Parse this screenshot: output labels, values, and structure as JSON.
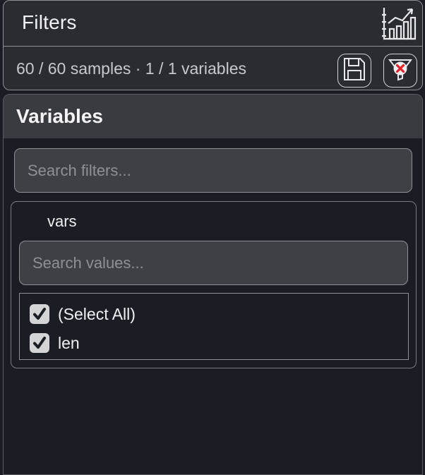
{
  "header": {
    "title": "Filters",
    "chart_icon": "bar-chart-icon"
  },
  "status": {
    "text": "60 / 60 samples · 1 / 1 variables",
    "save_icon": "floppy-disk-icon",
    "clear_icon": "clear-filter-icon",
    "clear_accent": "#e0242c"
  },
  "panel": {
    "title": "Variables",
    "search_placeholder": "Search filters..."
  },
  "variable": {
    "name": "vars",
    "search_placeholder": "Search values...",
    "values": [
      {
        "label": "(Select All)",
        "checked": true
      },
      {
        "label": "len",
        "checked": true
      }
    ]
  }
}
